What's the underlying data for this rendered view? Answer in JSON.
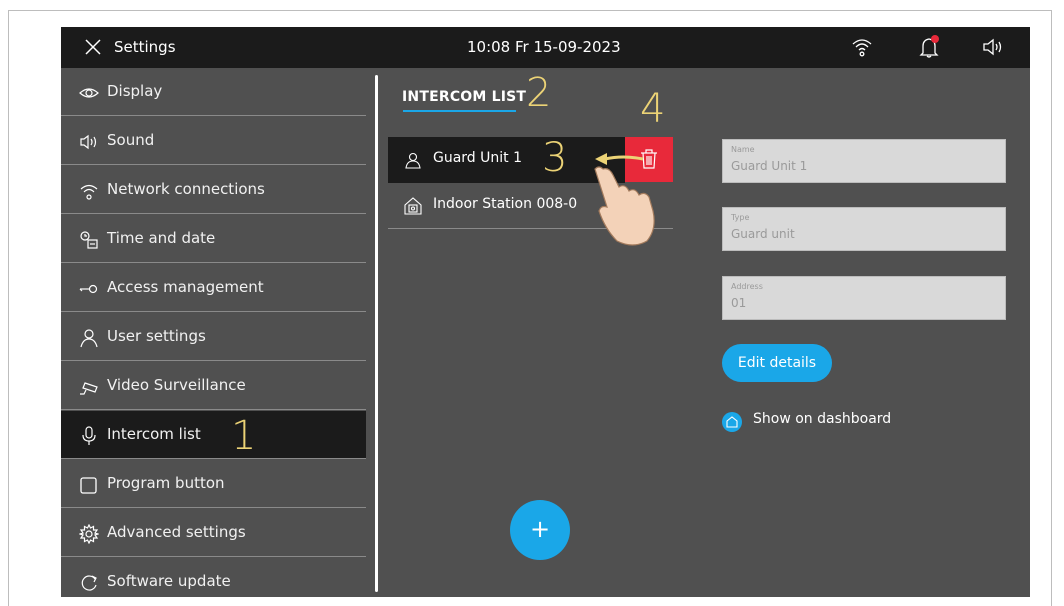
{
  "topbar": {
    "title": "Settings",
    "datetime": "10:08  Fr 15-09-2023",
    "icons": [
      "close-icon",
      "wifi-icon",
      "bell-icon",
      "speaker-icon"
    ],
    "notification_dot_color": "#e8293a"
  },
  "sidebar": {
    "items": [
      {
        "label": "Display",
        "icon": "eye-icon"
      },
      {
        "label": "Sound",
        "icon": "speaker-icon"
      },
      {
        "label": "Network connections",
        "icon": "wifi-icon"
      },
      {
        "label": "Time and date",
        "icon": "clock-calendar-icon"
      },
      {
        "label": "Access  management",
        "icon": "key-icon"
      },
      {
        "label": "User settings",
        "icon": "user-icon"
      },
      {
        "label": "Video Surveillance",
        "icon": "camera-icon"
      },
      {
        "label": "Intercom list",
        "icon": "microphone-icon",
        "active": true
      },
      {
        "label": "Program button",
        "icon": "square-icon"
      },
      {
        "label": "Advanced settings",
        "icon": "gear-icon"
      },
      {
        "label": "Software update",
        "icon": "refresh-icon"
      }
    ]
  },
  "intercom": {
    "title": "INTERCOM LIST",
    "items": [
      {
        "label": "Guard Unit 1",
        "icon": "user-icon",
        "selected": true
      },
      {
        "label": "Indoor Station 008-0",
        "icon": "house-icon"
      }
    ],
    "delete_icon": "trash-icon",
    "add_label": "+"
  },
  "details": {
    "name_label": "Name",
    "name_value": "Guard Unit 1",
    "type_label": "Type",
    "type_value": "Guard unit",
    "address_label": "Address",
    "address_value": "01",
    "edit_button": "Edit details",
    "dashboard_label": "Show on dashboard"
  },
  "annotations": {
    "step1": "1",
    "step2": "2",
    "step3": "3",
    "step4": "4"
  },
  "colors": {
    "accent": "#1aa7e8",
    "delete": "#e8293a",
    "background": "#505050",
    "topbar": "#1b1b1b",
    "annotation": "#ecd376"
  }
}
